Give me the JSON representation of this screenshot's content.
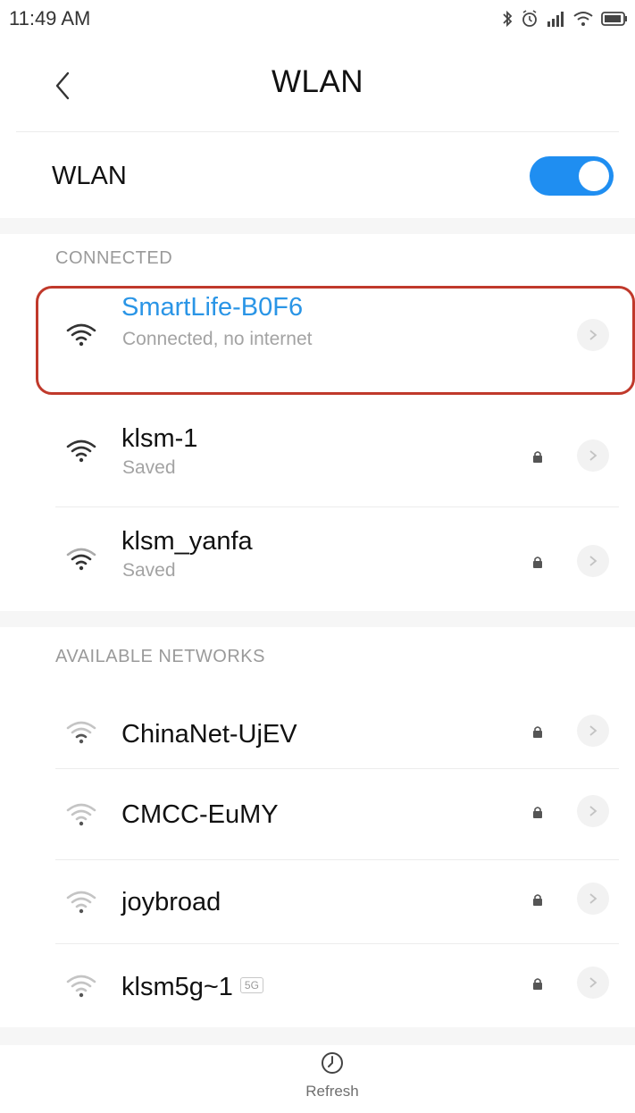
{
  "status_bar": {
    "time": "11:49 AM",
    "icons": [
      "bluetooth-icon",
      "alarm-icon",
      "cellular-signal-icon",
      "wifi-status-icon",
      "battery-icon"
    ]
  },
  "header": {
    "title": "WLAN",
    "back_icon": "chevron-left-icon"
  },
  "wlan_toggle": {
    "label": "WLAN",
    "enabled": true,
    "accent_color": "#1f8ef1"
  },
  "sections": {
    "connected_label": "CONNECTED",
    "available_label": "AVAILABLE NETWORKS"
  },
  "connected_networks": [
    {
      "name": "SmartLife-B0F6",
      "status": "Connected, no internet",
      "secured": false,
      "signal": "strong",
      "highlighted": true
    },
    {
      "name": "klsm-1",
      "status": "Saved",
      "secured": true,
      "signal": "strong"
    },
    {
      "name": "klsm_yanfa",
      "status": "Saved",
      "secured": true,
      "signal": "medium"
    }
  ],
  "available_networks": [
    {
      "name": "ChinaNet-UjEV",
      "secured": true,
      "signal": "weak"
    },
    {
      "name": "CMCC-EuMY",
      "secured": true,
      "signal": "weak"
    },
    {
      "name": "joybroad",
      "secured": true,
      "signal": "weak"
    },
    {
      "name": "klsm5g~1",
      "badge": "5G",
      "secured": true,
      "signal": "weak"
    }
  ],
  "bottom_bar": {
    "refresh_label": "Refresh"
  },
  "colors": {
    "connected_text": "#2a95e6",
    "highlight_border": "#c0392b"
  }
}
